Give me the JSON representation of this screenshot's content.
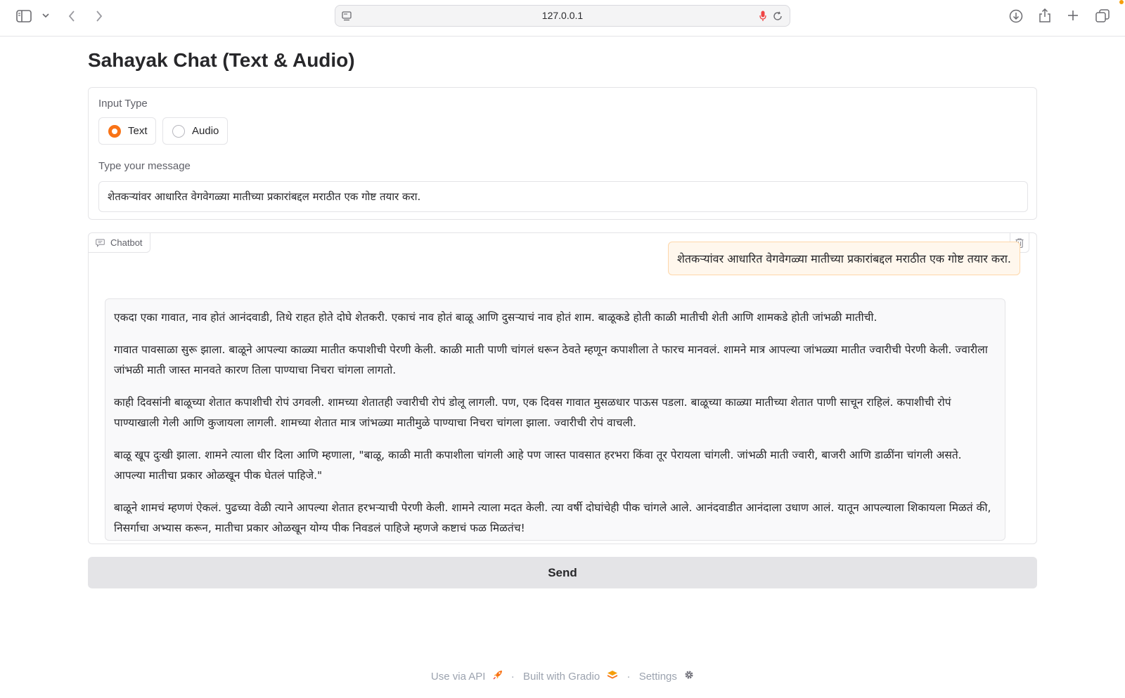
{
  "browser": {
    "url": "127.0.0.1"
  },
  "page": {
    "title": "Sahayak Chat (Text & Audio)"
  },
  "input_type": {
    "label": "Input Type",
    "options": [
      {
        "label": "Text",
        "selected": true
      },
      {
        "label": "Audio",
        "selected": false
      }
    ]
  },
  "message": {
    "label": "Type your message",
    "value": "शेतकऱ्यांवर आधारित वेगवेगळ्या मातीच्या प्रकारांबद्दल मराठीत एक गोष्ट तयार करा."
  },
  "chatbot": {
    "label": "Chatbot",
    "user_message": "शेतकऱ्यांवर आधारित वेगवेगळ्या मातीच्या प्रकारांबद्दल मराठीत एक गोष्ट तयार करा.",
    "bot_paragraphs": [
      "एकदा एका गावात, नाव होतं आनंदवाडी, तिथे राहत होते दोघे शेतकरी. एकाचं नाव होतं बाळू आणि दुसऱ्याचं नाव होतं शाम. बाळूकडे होती काळी मातीची शेती आणि शामकडे होती जांभळी मातीची.",
      "गावात पावसाळा सुरू झाला. बाळूने आपल्या काळ्या मातीत कपाशीची पेरणी केली. काळी माती पाणी चांगलं धरून ठेवते म्हणून कपाशीला ते फारच मानवलं. शामने मात्र आपल्या जांभळ्या मातीत ज्वारीची पेरणी केली. ज्वारीला जांभळी माती जास्त मानवते कारण तिला पाण्याचा निचरा चांगला लागतो.",
      "काही दिवसांनी बाळूच्या शेतात कपाशीची रोपं उगवली. शामच्या शेतातही ज्वारीची रोपं डोलू लागली. पण, एक दिवस गावात मुसळधार पाऊस पडला. बाळूच्या काळ्या मातीच्या शेतात पाणी साचून राहिलं. कपाशीची रोपं पाण्याखाली गेली आणि कुजायला लागली. शामच्या शेतात मात्र जांभळ्या मातीमुळे पाण्याचा निचरा चांगला झाला. ज्वारीची रोपं वाचली.",
      "बाळू खूप दुःखी झाला. शामने त्याला धीर दिला आणि म्हणाला, \"बाळू, काळी माती कपाशीला चांगली आहे पण जास्त पावसात हरभरा किंवा तूर पेरायला चांगली. जांभळी माती ज्वारी, बाजरी आणि डाळींना चांगली असते. आपल्या मातीचा प्रकार ओळखून पीक घेतलं पाहिजे.\"",
      "बाळूने शामचं म्हणणं ऐकलं. पुढच्या वेळी त्याने आपल्या शेतात हरभऱ्याची पेरणी केली. शामने त्याला मदत केली. त्या वर्षी दोघांचेही पीक चांगले आले. आनंदवाडीत आनंदाला उधाण आलं. यातून आपल्याला शिकायला मिळतं की, निसर्गाचा अभ्यास करून, मातीचा प्रकार ओळखून योग्य पीक निवडलं पाहिजे म्हणजे कष्टाचं फळ मिळतंच!"
    ]
  },
  "send_button": "Send",
  "footer": {
    "api": "Use via API",
    "built": "Built with Gradio",
    "settings": "Settings",
    "separator": "·"
  },
  "colors": {
    "accent": "#f97316",
    "user_bubble_bg": "#fff7ed",
    "user_bubble_border": "#fed7aa"
  }
}
